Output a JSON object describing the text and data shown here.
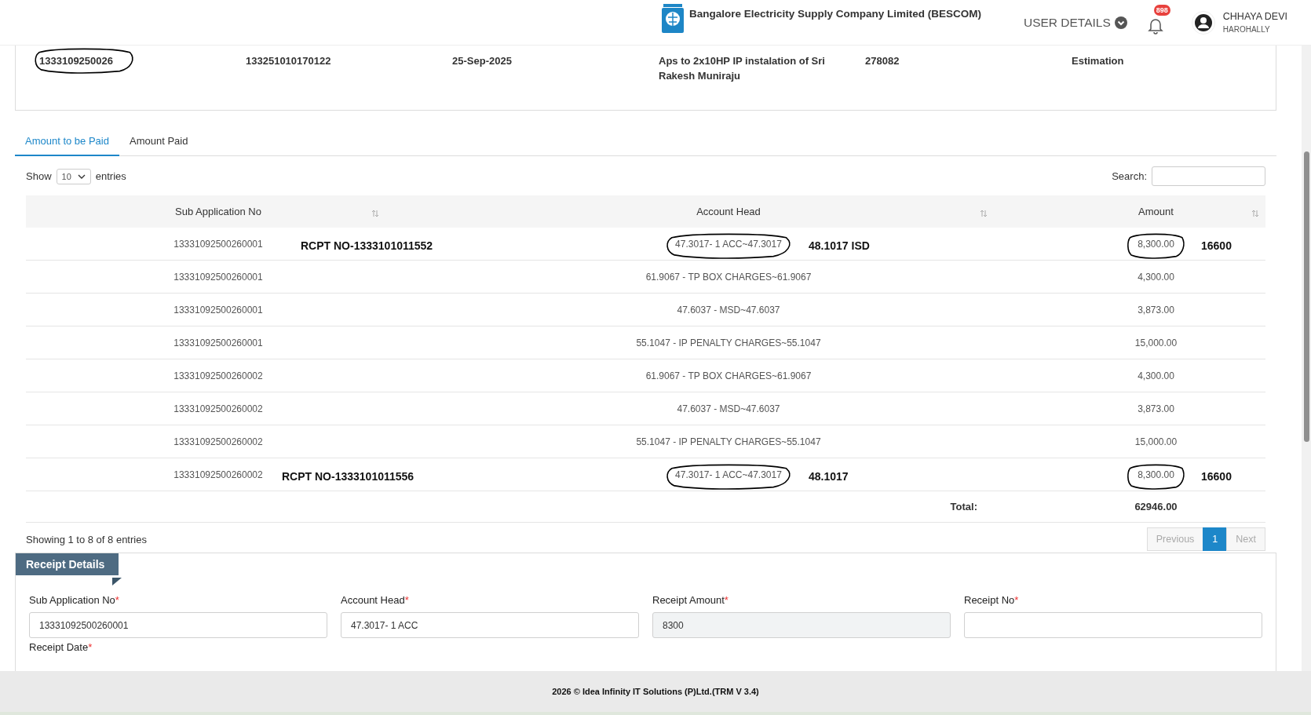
{
  "header": {
    "company": "Bangalore Electricity Supply Company Limited (BESCOM)",
    "user_menu": "USER DETAILS",
    "notifications": "898",
    "user": {
      "name": "CHHAYA DEVI",
      "location": "HAROHALLY"
    }
  },
  "application": [
    {
      "value": "1333109250026",
      "circled": true
    },
    {
      "value": "133251010170122",
      "circled": false
    },
    {
      "value": "25-Sep-2025",
      "circled": false
    },
    {
      "value": "Aps to 2x10HP IP instalation of Sri Rakesh Muniraju",
      "circled": false
    },
    {
      "value": "278082",
      "circled": false
    },
    {
      "value": "Estimation",
      "circled": false
    }
  ],
  "tabs": [
    {
      "label": "Amount to be Paid",
      "selected": true
    },
    {
      "label": "Amount Paid",
      "selected": false
    }
  ],
  "table_controls": {
    "show_label": "Show",
    "page_size": "10",
    "entries_label": "entries",
    "search_label": "Search:"
  },
  "table": {
    "columns": [
      "Sub Application No",
      "Account Head",
      "Amount"
    ],
    "rows": [
      {
        "sub_application_no": "13331092500260001",
        "account_head": "47.3017- 1 ACC~47.3017",
        "amount": "8,300.00",
        "circled": true,
        "notes": [
          {
            "kind": "receipt",
            "text": "RCPT NO-1333101011552"
          },
          {
            "kind": "head",
            "text": "48.1017 ISD"
          },
          {
            "kind": "amount",
            "text": "16600"
          }
        ]
      },
      {
        "sub_application_no": "13331092500260001",
        "account_head": "61.9067 - TP BOX CHARGES~61.9067",
        "amount": "4,300.00",
        "circled": false
      },
      {
        "sub_application_no": "13331092500260001",
        "account_head": "47.6037 - MSD~47.6037",
        "amount": "3,873.00",
        "circled": false
      },
      {
        "sub_application_no": "13331092500260001",
        "account_head": "55.1047 - IP PENALTY CHARGES~55.1047",
        "amount": "15,000.00",
        "circled": false
      },
      {
        "sub_application_no": "13331092500260002",
        "account_head": "61.9067 - TP BOX CHARGES~61.9067",
        "amount": "4,300.00",
        "circled": false
      },
      {
        "sub_application_no": "13331092500260002",
        "account_head": "47.6037 - MSD~47.6037",
        "amount": "3,873.00",
        "circled": false
      },
      {
        "sub_application_no": "13331092500260002",
        "account_head": "55.1047 - IP PENALTY CHARGES~55.1047",
        "amount": "15,000.00",
        "circled": false
      },
      {
        "sub_application_no": "13331092500260002",
        "account_head": "47.3017- 1 ACC~47.3017",
        "amount": "8,300.00",
        "circled": true,
        "notes": [
          {
            "kind": "receipt",
            "text": "RCPT NO-1333101011556"
          },
          {
            "kind": "head",
            "text": "48.1017"
          },
          {
            "kind": "amount",
            "text": "16600"
          }
        ]
      }
    ],
    "total_label": "Total:",
    "total": "62946.00"
  },
  "info": "Showing 1 to 8 of 8 entries",
  "pagination": [
    {
      "label": "Previous",
      "selected": false,
      "disabled": true
    },
    {
      "label": "1",
      "selected": true,
      "disabled": false
    },
    {
      "label": "Next",
      "selected": false,
      "disabled": true
    }
  ],
  "receipt": {
    "title": "Receipt Details",
    "fields": [
      {
        "label": "Sub Application No",
        "required_mark": "*",
        "value": "13331092500260001",
        "readonly": false
      },
      {
        "label": "Account Head",
        "required_mark": "*",
        "value": "47.3017- 1 ACC",
        "readonly": false
      },
      {
        "label": "Receipt Amount",
        "required_mark": "*",
        "value": "8300",
        "readonly": true
      },
      {
        "label": "Receipt No",
        "required_mark": "*",
        "readonly": false
      }
    ],
    "date_label": {
      "label": "Receipt Date",
      "required_mark": "*"
    }
  },
  "footer": "2026 © Idea Infinity IT Solutions (P)Ltd.(TRM V 3.4)"
}
